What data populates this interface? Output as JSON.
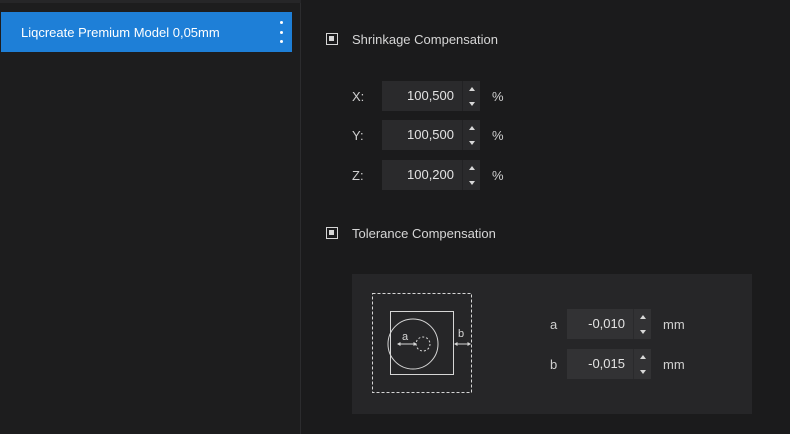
{
  "sidebar": {
    "selected_profile": "Liqcreate Premium Model 0,05mm"
  },
  "shrinkage": {
    "title": "Shrinkage Compensation",
    "checked": true,
    "rows": [
      {
        "axis": "X:",
        "value": "100,500",
        "unit": "%"
      },
      {
        "axis": "Y:",
        "value": "100,500",
        "unit": "%"
      },
      {
        "axis": "Z:",
        "value": "100,200",
        "unit": "%"
      }
    ]
  },
  "tolerance": {
    "title": "Tolerance Compensation",
    "checked": true,
    "diagram": {
      "label_a": "a",
      "label_b": "b"
    },
    "rows": [
      {
        "axis": "a",
        "value": "-0,010",
        "unit": "mm"
      },
      {
        "axis": "b",
        "value": "-0,015",
        "unit": "mm"
      }
    ]
  },
  "colors": {
    "accent": "#1e7fd7",
    "background": "#1b1b1c",
    "panel": "#262628"
  }
}
